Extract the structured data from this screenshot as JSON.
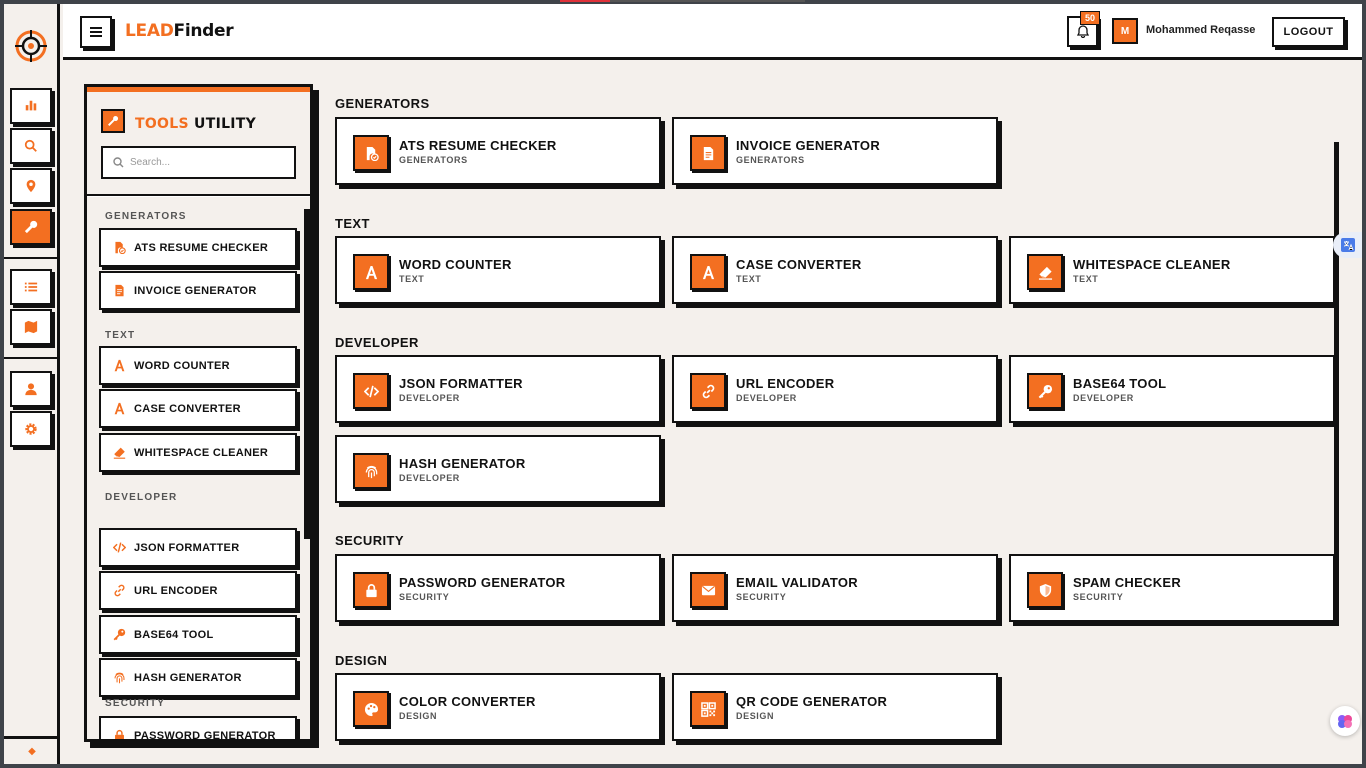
{
  "app": {
    "brand_accent": "LEAD",
    "brand_rest": "Finder"
  },
  "colors": {
    "accent": "#f36f21",
    "ink": "#111111",
    "background": "#f4f0ec"
  },
  "header": {
    "notification_count": "50",
    "avatar_initial": "M",
    "user_name": "Mohammed Reqasse",
    "logout_label": "LOGOUT"
  },
  "rail": {
    "items": [
      {
        "icon": "bar-chart-icon",
        "active": false
      },
      {
        "icon": "search-icon",
        "active": false
      },
      {
        "icon": "map-pin-icon",
        "active": false
      },
      {
        "icon": "wrench-icon",
        "active": true
      },
      {
        "icon": "list-icon",
        "active": false
      },
      {
        "icon": "map-icon",
        "active": false
      },
      {
        "icon": "user-icon",
        "active": false
      },
      {
        "icon": "gear-icon",
        "active": false
      }
    ],
    "footer_icon": "diamond-icon"
  },
  "panel": {
    "title_accent": "TOOLS",
    "title_rest": "UTILITY",
    "search_placeholder": "Search...",
    "categories": [
      {
        "label": "GENERATORS",
        "items": [
          "ATS RESUME CHECKER",
          "INVOICE GENERATOR"
        ]
      },
      {
        "label": "TEXT",
        "items": [
          "WORD COUNTER",
          "CASE CONVERTER",
          "WHITESPACE CLEANER"
        ]
      },
      {
        "label": "DEVELOPER",
        "items": [
          "JSON FORMATTER",
          "URL ENCODER",
          "BASE64 TOOL",
          "HASH GENERATOR"
        ]
      },
      {
        "label": "SECURITY",
        "items": [
          "PASSWORD GENERATOR"
        ]
      }
    ]
  },
  "main": {
    "sections": [
      {
        "label": "GENERATORS",
        "tools": [
          {
            "title": "ATS RESUME CHECKER",
            "sub": "GENERATORS",
            "icon": "file-check-icon"
          },
          {
            "title": "INVOICE GENERATOR",
            "sub": "GENERATORS",
            "icon": "file-invoice-icon"
          }
        ]
      },
      {
        "label": "TEXT",
        "tools": [
          {
            "title": "WORD COUNTER",
            "sub": "TEXT",
            "icon": "font-icon"
          },
          {
            "title": "CASE CONVERTER",
            "sub": "TEXT",
            "icon": "font-icon"
          },
          {
            "title": "WHITESPACE CLEANER",
            "sub": "TEXT",
            "icon": "eraser-icon"
          }
        ]
      },
      {
        "label": "DEVELOPER",
        "tools": [
          {
            "title": "JSON FORMATTER",
            "sub": "DEVELOPER",
            "icon": "code-icon"
          },
          {
            "title": "URL ENCODER",
            "sub": "DEVELOPER",
            "icon": "link-icon"
          },
          {
            "title": "BASE64 TOOL",
            "sub": "DEVELOPER",
            "icon": "key-icon"
          },
          {
            "title": "HASH GENERATOR",
            "sub": "DEVELOPER",
            "icon": "fingerprint-icon"
          }
        ]
      },
      {
        "label": "SECURITY",
        "tools": [
          {
            "title": "PASSWORD GENERATOR",
            "sub": "SECURITY",
            "icon": "lock-icon"
          },
          {
            "title": "EMAIL VALIDATOR",
            "sub": "SECURITY",
            "icon": "envelope-icon"
          },
          {
            "title": "SPAM CHECKER",
            "sub": "SECURITY",
            "icon": "shield-icon"
          }
        ]
      },
      {
        "label": "DESIGN",
        "tools": [
          {
            "title": "COLOR CONVERTER",
            "sub": "DESIGN",
            "icon": "palette-icon"
          },
          {
            "title": "QR CODE GENERATOR",
            "sub": "DESIGN",
            "icon": "qr-code-icon"
          }
        ]
      }
    ]
  }
}
